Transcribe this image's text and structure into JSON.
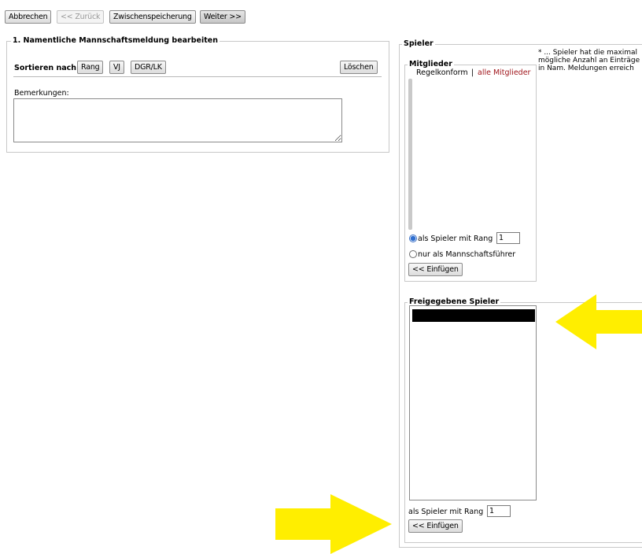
{
  "toolbar": {
    "cancel": "Abbrechen",
    "back": "<< Zurück",
    "save_draft": "Zwischenspeicherung",
    "next": "Weiter >>"
  },
  "left_panel": {
    "legend": "1. Namentliche Mannschaftsmeldung bearbeiten",
    "sort_label": "Sortieren nach:",
    "sort_rank": "Rang",
    "sort_vj": "VJ",
    "sort_dgr": "DGR/LK",
    "delete": "Löschen",
    "remarks_label": "Bemerkungen:",
    "remarks_value": ""
  },
  "right_panel": {
    "legend": "Spieler",
    "note": [
      "* ... Spieler hat die maximal",
      "mögliche Anzahl an Einträge",
      "in Nam. Meldungen erreich"
    ],
    "members": {
      "legend": "Mitglieder",
      "filter_conform": "Regelkonform",
      "filter_sep": "|",
      "filter_all": "alle Mitglieder",
      "radio_player": "als Spieler mit Rang",
      "rank_value": "1",
      "radio_captain": "nur als Mannschaftsführer",
      "insert": "<< Einfügen"
    },
    "released": {
      "legend": "Freigegebene Spieler",
      "rank_label": "als Spieler mit Rang",
      "rank_value": "1",
      "insert": "<< Einfügen"
    }
  },
  "colors": {
    "highlight_arrow": "#ffee00",
    "link_red": "#a0161c"
  }
}
